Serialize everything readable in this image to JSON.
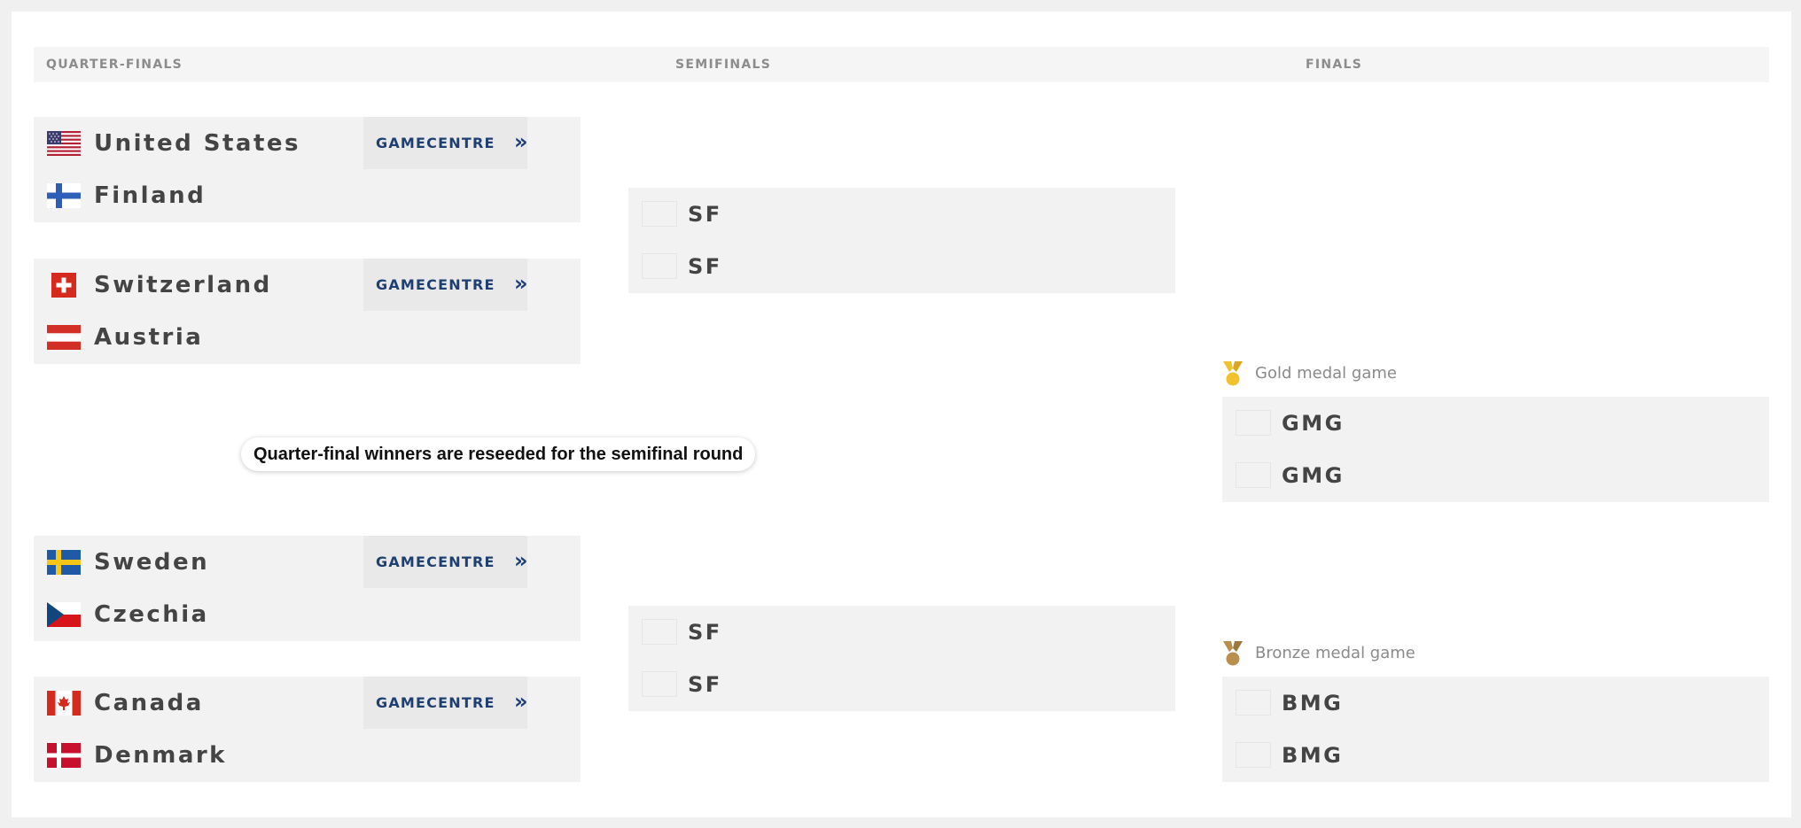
{
  "rounds": {
    "quarterfinals": "QUARTER-FINALS",
    "semifinals": "SEMIFINALS",
    "finals": "FINALS"
  },
  "gamecentre_label": "GAMECENTRE",
  "gamecentre_arrow": "»",
  "quarterfinals": [
    {
      "home": "United States",
      "away": "Finland"
    },
    {
      "home": "Switzerland",
      "away": "Austria"
    },
    {
      "home": "Sweden",
      "away": "Czechia"
    },
    {
      "home": "Canada",
      "away": "Denmark"
    }
  ],
  "reseed_note": "Quarter-final winners are reseeded for the semifinal round",
  "semifinals": [
    {
      "top": "SF",
      "bottom": "SF"
    },
    {
      "top": "SF",
      "bottom": "SF"
    }
  ],
  "finals": {
    "gold": {
      "title": "Gold medal game",
      "top": "GMG",
      "bottom": "GMG"
    },
    "bronze": {
      "title": "Bronze medal game",
      "top": "BMG",
      "bottom": "BMG"
    }
  },
  "colors": {
    "gamecentre": "#1d3f72",
    "gold_medal": "#f2c12e",
    "bronze_medal": "#b88f4f"
  },
  "icons": {
    "flags": [
      "flag-usa-icon",
      "flag-finland-icon",
      "flag-switzerland-icon",
      "flag-austria-icon",
      "flag-sweden-icon",
      "flag-czechia-icon",
      "flag-canada-icon",
      "flag-denmark-icon"
    ],
    "gold": "gold-medal-icon",
    "bronze": "bronze-medal-icon",
    "gamecentre": "double-chevron-right-icon"
  }
}
